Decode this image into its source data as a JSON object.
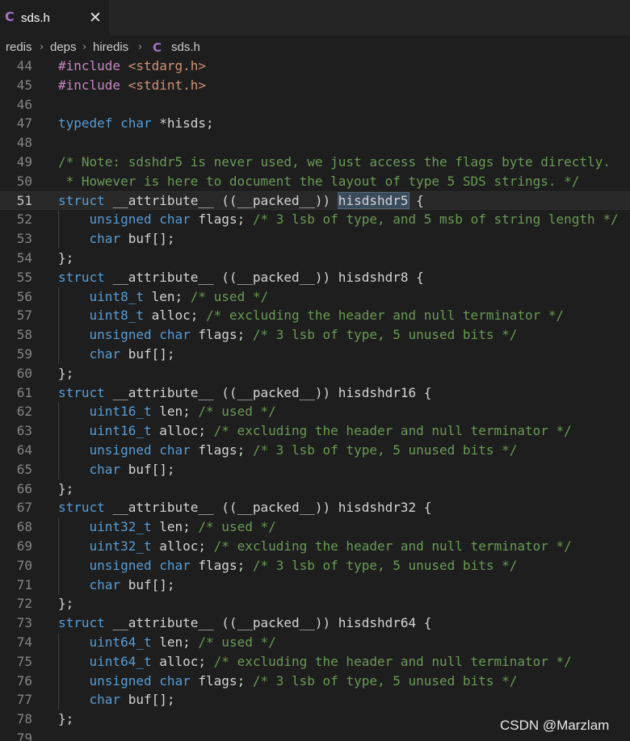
{
  "tab": {
    "icon_letter": "C",
    "label": "sds.h",
    "close_glyph": "✕",
    "icon_color": "#a074c4"
  },
  "breadcrumb": {
    "items": [
      "redis",
      "deps",
      "hiredis"
    ],
    "file_icon_letter": "C",
    "file": "sds.h",
    "separator": "›"
  },
  "editor": {
    "current_line": 51,
    "highlighted_word": "hisdshdr5",
    "lines": [
      {
        "n": "44",
        "tokens": [
          [
            "inc",
            "#include "
          ],
          [
            "str",
            "<stdarg.h>"
          ]
        ]
      },
      {
        "n": "45",
        "tokens": [
          [
            "inc",
            "#include "
          ],
          [
            "str",
            "<stdint.h>"
          ]
        ]
      },
      {
        "n": "46",
        "tokens": []
      },
      {
        "n": "47",
        "tokens": [
          [
            "kw",
            "typedef "
          ],
          [
            "kw",
            "char "
          ],
          [
            "plain",
            "*hisds;"
          ]
        ]
      },
      {
        "n": "48",
        "tokens": []
      },
      {
        "n": "49",
        "tokens": [
          [
            "cm",
            "/* Note: sdshdr5 is never used, we just access the flags byte directly."
          ]
        ]
      },
      {
        "n": "50",
        "tokens": [
          [
            "cm",
            " * However is here to document the layout of type 5 SDS strings. */"
          ]
        ]
      },
      {
        "n": "51",
        "tokens": [
          [
            "kw",
            "struct "
          ],
          [
            "plain",
            "__attribute__ ((__packed__)) "
          ],
          [
            "hl",
            "hisdshdr5"
          ],
          [
            "plain",
            " {"
          ]
        ]
      },
      {
        "n": "52",
        "tokens": [
          [
            "plain",
            "    "
          ],
          [
            "kw",
            "unsigned "
          ],
          [
            "kw",
            "char "
          ],
          [
            "plain",
            "flags; "
          ],
          [
            "cm",
            "/* 3 lsb of type, and 5 msb of string length */"
          ]
        ]
      },
      {
        "n": "53",
        "tokens": [
          [
            "plain",
            "    "
          ],
          [
            "kw",
            "char "
          ],
          [
            "plain",
            "buf[];"
          ]
        ]
      },
      {
        "n": "54",
        "tokens": [
          [
            "plain",
            "};"
          ]
        ]
      },
      {
        "n": "55",
        "tokens": [
          [
            "kw",
            "struct "
          ],
          [
            "plain",
            "__attribute__ ((__packed__)) hisdshdr8 {"
          ]
        ]
      },
      {
        "n": "56",
        "tokens": [
          [
            "plain",
            "    "
          ],
          [
            "kw",
            "uint8_t "
          ],
          [
            "plain",
            "len; "
          ],
          [
            "cm",
            "/* used */"
          ]
        ]
      },
      {
        "n": "57",
        "tokens": [
          [
            "plain",
            "    "
          ],
          [
            "kw",
            "uint8_t "
          ],
          [
            "plain",
            "alloc; "
          ],
          [
            "cm",
            "/* excluding the header and null terminator */"
          ]
        ]
      },
      {
        "n": "58",
        "tokens": [
          [
            "plain",
            "    "
          ],
          [
            "kw",
            "unsigned "
          ],
          [
            "kw",
            "char "
          ],
          [
            "plain",
            "flags; "
          ],
          [
            "cm",
            "/* 3 lsb of type, 5 unused bits */"
          ]
        ]
      },
      {
        "n": "59",
        "tokens": [
          [
            "plain",
            "    "
          ],
          [
            "kw",
            "char "
          ],
          [
            "plain",
            "buf[];"
          ]
        ]
      },
      {
        "n": "60",
        "tokens": [
          [
            "plain",
            "};"
          ]
        ]
      },
      {
        "n": "61",
        "tokens": [
          [
            "kw",
            "struct "
          ],
          [
            "plain",
            "__attribute__ ((__packed__)) hisdshdr16 {"
          ]
        ]
      },
      {
        "n": "62",
        "tokens": [
          [
            "plain",
            "    "
          ],
          [
            "kw",
            "uint16_t "
          ],
          [
            "plain",
            "len; "
          ],
          [
            "cm",
            "/* used */"
          ]
        ]
      },
      {
        "n": "63",
        "tokens": [
          [
            "plain",
            "    "
          ],
          [
            "kw",
            "uint16_t "
          ],
          [
            "plain",
            "alloc; "
          ],
          [
            "cm",
            "/* excluding the header and null terminator */"
          ]
        ]
      },
      {
        "n": "64",
        "tokens": [
          [
            "plain",
            "    "
          ],
          [
            "kw",
            "unsigned "
          ],
          [
            "kw",
            "char "
          ],
          [
            "plain",
            "flags; "
          ],
          [
            "cm",
            "/* 3 lsb of type, 5 unused bits */"
          ]
        ]
      },
      {
        "n": "65",
        "tokens": [
          [
            "plain",
            "    "
          ],
          [
            "kw",
            "char "
          ],
          [
            "plain",
            "buf[];"
          ]
        ]
      },
      {
        "n": "66",
        "tokens": [
          [
            "plain",
            "};"
          ]
        ]
      },
      {
        "n": "67",
        "tokens": [
          [
            "kw",
            "struct "
          ],
          [
            "plain",
            "__attribute__ ((__packed__)) hisdshdr32 {"
          ]
        ]
      },
      {
        "n": "68",
        "tokens": [
          [
            "plain",
            "    "
          ],
          [
            "kw",
            "uint32_t "
          ],
          [
            "plain",
            "len; "
          ],
          [
            "cm",
            "/* used */"
          ]
        ]
      },
      {
        "n": "69",
        "tokens": [
          [
            "plain",
            "    "
          ],
          [
            "kw",
            "uint32_t "
          ],
          [
            "plain",
            "alloc; "
          ],
          [
            "cm",
            "/* excluding the header and null terminator */"
          ]
        ]
      },
      {
        "n": "70",
        "tokens": [
          [
            "plain",
            "    "
          ],
          [
            "kw",
            "unsigned "
          ],
          [
            "kw",
            "char "
          ],
          [
            "plain",
            "flags; "
          ],
          [
            "cm",
            "/* 3 lsb of type, 5 unused bits */"
          ]
        ]
      },
      {
        "n": "71",
        "tokens": [
          [
            "plain",
            "    "
          ],
          [
            "kw",
            "char "
          ],
          [
            "plain",
            "buf[];"
          ]
        ]
      },
      {
        "n": "72",
        "tokens": [
          [
            "plain",
            "};"
          ]
        ]
      },
      {
        "n": "73",
        "tokens": [
          [
            "kw",
            "struct "
          ],
          [
            "plain",
            "__attribute__ ((__packed__)) hisdshdr64 {"
          ]
        ]
      },
      {
        "n": "74",
        "tokens": [
          [
            "plain",
            "    "
          ],
          [
            "kw",
            "uint64_t "
          ],
          [
            "plain",
            "len; "
          ],
          [
            "cm",
            "/* used */"
          ]
        ]
      },
      {
        "n": "75",
        "tokens": [
          [
            "plain",
            "    "
          ],
          [
            "kw",
            "uint64_t "
          ],
          [
            "plain",
            "alloc; "
          ],
          [
            "cm",
            "/* excluding the header and null terminator */"
          ]
        ]
      },
      {
        "n": "76",
        "tokens": [
          [
            "plain",
            "    "
          ],
          [
            "kw",
            "unsigned "
          ],
          [
            "kw",
            "char "
          ],
          [
            "plain",
            "flags; "
          ],
          [
            "cm",
            "/* 3 lsb of type, 5 unused bits */"
          ]
        ]
      },
      {
        "n": "77",
        "tokens": [
          [
            "plain",
            "    "
          ],
          [
            "kw",
            "char "
          ],
          [
            "plain",
            "buf[];"
          ]
        ]
      },
      {
        "n": "78",
        "tokens": [
          [
            "plain",
            "};"
          ]
        ]
      },
      {
        "n": "79",
        "tokens": []
      }
    ]
  },
  "watermark": "CSDN @Marzlam"
}
